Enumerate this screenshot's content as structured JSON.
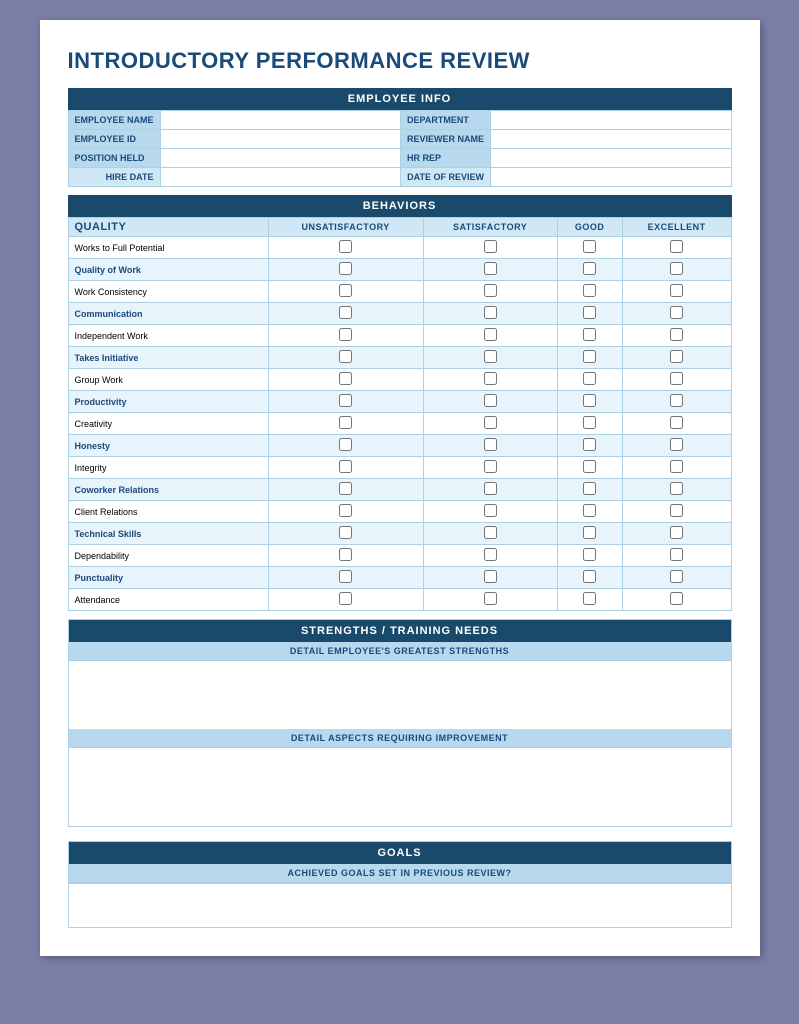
{
  "title": "INTRODUCTORY PERFORMANCE REVIEW",
  "employeeInfo": {
    "sectionHeader": "EMPLOYEE INFO",
    "fields": [
      {
        "label": "EMPLOYEE NAME",
        "value": "",
        "label2": "DEPARTMENT",
        "value2": ""
      },
      {
        "label": "EMPLOYEE ID",
        "value": "",
        "label2": "REVIEWER NAME",
        "value2": ""
      },
      {
        "label": "POSITION HELD",
        "value": "",
        "label2": "HR REP",
        "value2": ""
      }
    ],
    "dateRow": {
      "hireLabel": "HIRE DATE",
      "hireValue": "",
      "reviewLabel": "DATE OF REVIEW",
      "reviewValue": ""
    }
  },
  "behaviors": {
    "sectionHeader": "BEHAVIORS",
    "columns": {
      "quality": "QUALITY",
      "unsatisfactory": "UNSATISFACTORY",
      "satisfactory": "SATISFACTORY",
      "good": "GOOD",
      "excellent": "EXCELLENT"
    },
    "rows": [
      {
        "name": "Works to Full Potential",
        "bold": false
      },
      {
        "name": "Quality of Work",
        "bold": true
      },
      {
        "name": "Work Consistency",
        "bold": false
      },
      {
        "name": "Communication",
        "bold": true
      },
      {
        "name": "Independent Work",
        "bold": false
      },
      {
        "name": "Takes Initiative",
        "bold": true
      },
      {
        "name": "Group Work",
        "bold": false
      },
      {
        "name": "Productivity",
        "bold": true
      },
      {
        "name": "Creativity",
        "bold": false
      },
      {
        "name": "Honesty",
        "bold": true
      },
      {
        "name": "Integrity",
        "bold": false
      },
      {
        "name": "Coworker Relations",
        "bold": true
      },
      {
        "name": "Client Relations",
        "bold": false
      },
      {
        "name": "Technical Skills",
        "bold": true
      },
      {
        "name": "Dependability",
        "bold": false
      },
      {
        "name": "Punctuality",
        "bold": true
      },
      {
        "name": "Attendance",
        "bold": false
      }
    ]
  },
  "strengths": {
    "sectionHeader": "STRENGTHS / TRAINING NEEDS",
    "strengthsSubHeader": "DETAIL EMPLOYEE'S GREATEST STRENGTHS",
    "improvementSubHeader": "DETAIL ASPECTS REQUIRING IMPROVEMENT"
  },
  "goals": {
    "sectionHeader": "GOALS",
    "achievedSubHeader": "ACHIEVED GOALS SET IN PREVIOUS REVIEW?"
  }
}
